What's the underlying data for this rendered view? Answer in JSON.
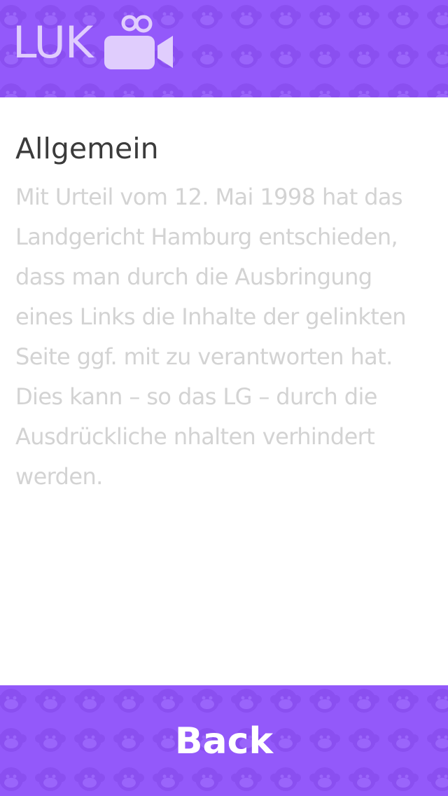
{
  "header": {
    "logo_text": "LUK",
    "logo_icon": "video-camera-icon"
  },
  "main": {
    "title": "Allgemein",
    "paragraph": "Mit Urteil vom 12. Mai 1998 hat das Landgericht Hamburg entschieden, dass man durch die Ausbringung eines Links die Inhalte der gelinkten Seite ggf. mit zu verantworten hat. Dies kann – so das LG – durch die Ausdrückliche nhalten verhindert werden."
  },
  "footer": {
    "back_label": "Back"
  },
  "colors": {
    "brand_purple": "#9359fa",
    "logo_lavender": "#e0cdfd",
    "title_text": "#3b3b3b",
    "body_text": "#d3d3d3"
  }
}
